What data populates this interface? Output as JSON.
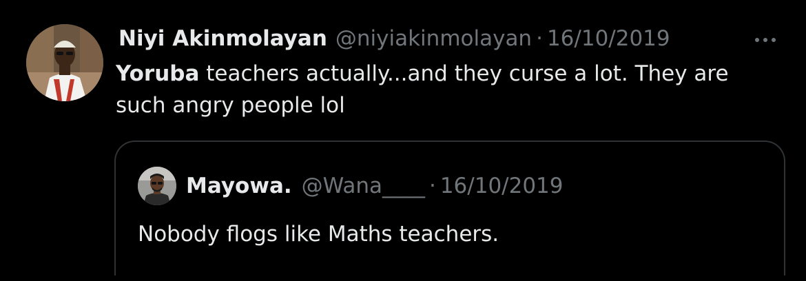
{
  "tweet": {
    "display_name": "Niyi Akinmolayan",
    "handle": "@niyiakinmolayan",
    "separator": "·",
    "date": "16/10/2019",
    "text_bold": "Yoruba",
    "text_rest": " teachers actually...and they curse a lot. They are such angry people lol",
    "avatar_icon": "profile-photo",
    "more_icon": "more-horizontal-icon"
  },
  "quote": {
    "display_name": "Mayowa.",
    "handle": "@Wana____",
    "separator": "·",
    "date": "16/10/2019",
    "text": "Nobody flogs like Maths teachers.",
    "avatar_icon": "profile-photo"
  },
  "colors": {
    "background": "#000000",
    "primary_text": "#e7e9ea",
    "secondary_text": "#71767b",
    "border": "#2f3336"
  }
}
